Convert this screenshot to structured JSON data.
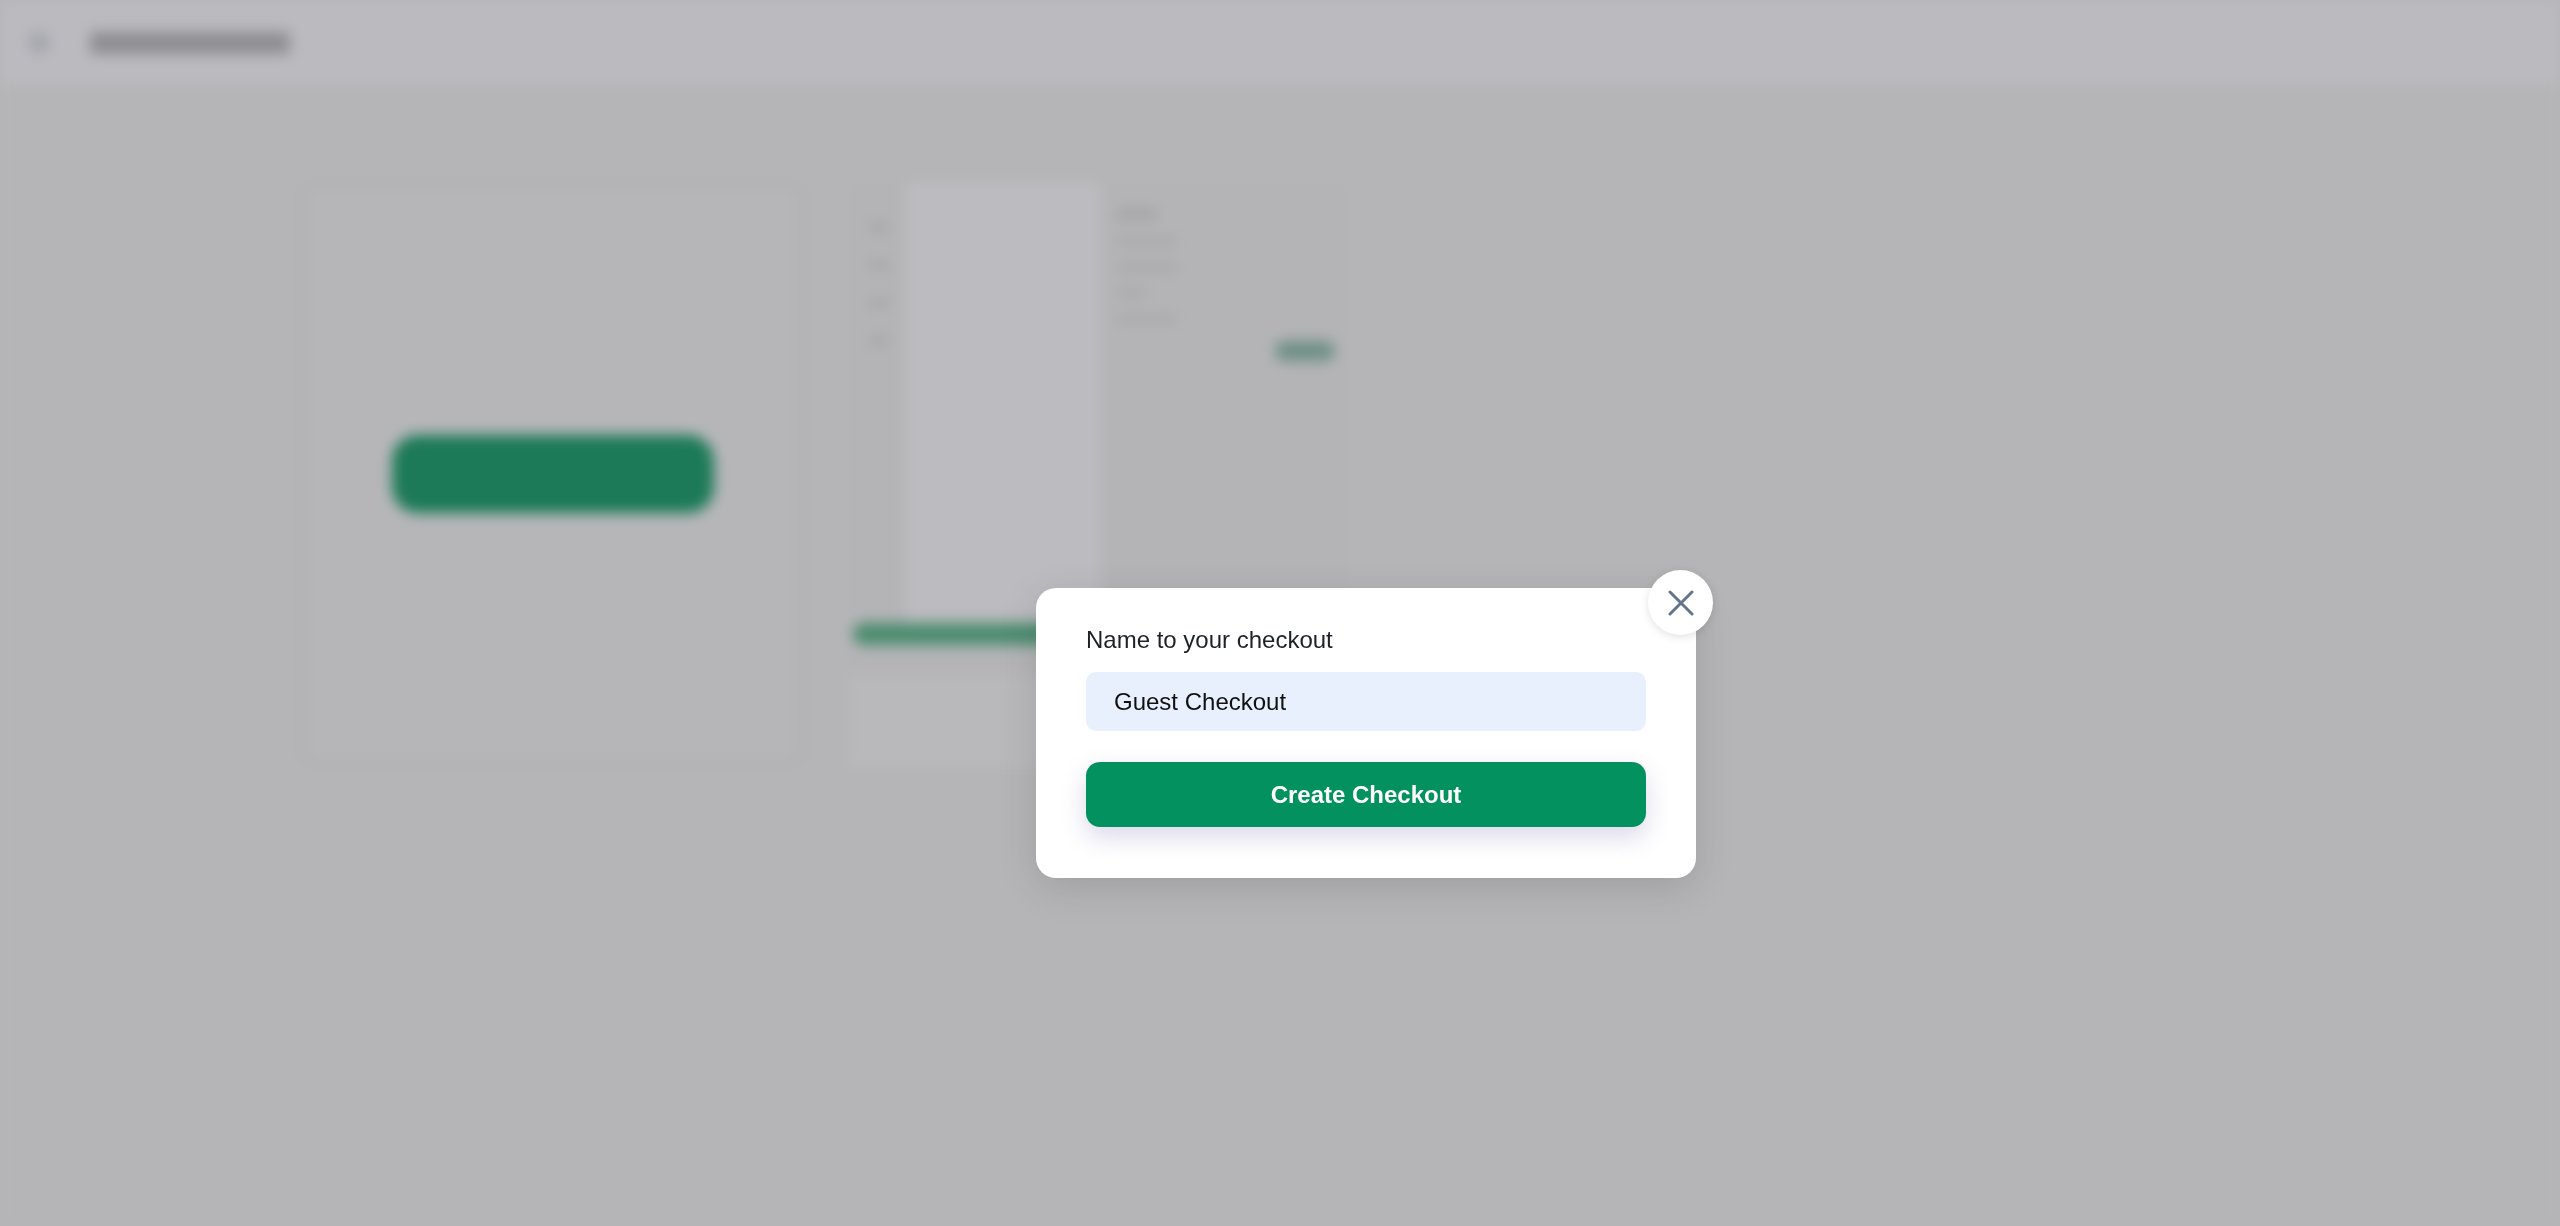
{
  "dialog": {
    "label": "Name to your checkout",
    "input": {
      "value": "Guest Checkout"
    },
    "submit_button": "Create Checkout"
  }
}
